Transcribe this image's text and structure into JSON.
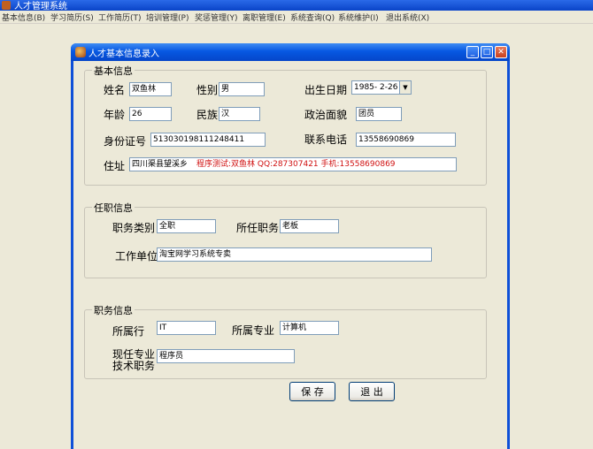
{
  "app": {
    "title": "人才管理系统"
  },
  "menu": [
    "基本信息(B)",
    "学习简历(S)",
    "工作简历(T)",
    "培训管理(P)",
    "奖惩管理(Y)",
    "离职管理(E)",
    "系统查询(Q)",
    "系统维护(I)",
    "退出系统(X)"
  ],
  "dialog": {
    "title": "人才基本信息录入"
  },
  "basic": {
    "legend": "基本信息",
    "name_label": "姓名",
    "name_value": "双鱼林",
    "gender_label": "性别",
    "gender_value": "男",
    "birth_label": "出生日期",
    "birth_value": "1985- 2-26",
    "age_label": "年龄",
    "age_value": "26",
    "ethnicity_label": "民族",
    "ethnicity_value": "汉",
    "political_label": "政治面貌",
    "political_value": "团员",
    "id_label": "身份证号",
    "id_value": "513030198111248411",
    "phone_label": "联系电话",
    "phone_value": "13558690869",
    "address_label": "住址",
    "address_value": "四川渠县望溪乡",
    "address_note": "程序测试:双鱼林 QQ:287307421 手机:13558690869"
  },
  "employment": {
    "legend": "任职信息",
    "type_label": "职务类别",
    "type_value": "全职",
    "position_label": "所任职务",
    "position_value": "老板",
    "employer_label": "工作单位",
    "employer_value": "淘宝网学习系统专卖"
  },
  "duty": {
    "legend": "职务信息",
    "industry_label": "所属行",
    "industry_value": "IT",
    "major_label": "所属专业",
    "major_value": "计算机",
    "tech_label_1": "现任专业",
    "tech_label_2": "技术职务",
    "tech_value": "程序员"
  },
  "buttons": {
    "save": "保 存",
    "exit": "退 出"
  },
  "colors": {
    "titlebar": "#0758e2",
    "window_bg": "#ece9d8",
    "note_red": "#d01010"
  }
}
